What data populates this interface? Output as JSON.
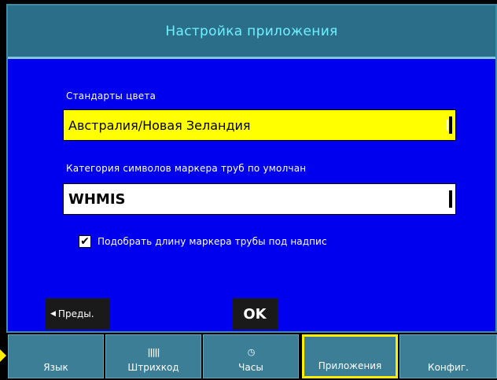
{
  "title": "Настройка приложения",
  "color_standards": {
    "label": "Стандарты цвета",
    "value": "Австралия/Новая Зеландия"
  },
  "pipe_marker_category": {
    "label": "Категория символов маркера труб по умолчан",
    "value": "WHMIS"
  },
  "fit_length": {
    "label": "Подобрать длину маркера трубы под надпис",
    "checked": true
  },
  "nav": {
    "prev_label": "Преды.",
    "ok_label": "OK"
  },
  "tabs": [
    {
      "label": "Язык",
      "icon": "",
      "icon_name": "",
      "active": false
    },
    {
      "label": "Штрихкод",
      "icon": "|||||",
      "icon_name": "barcode-icon",
      "active": false
    },
    {
      "label": "Часы",
      "icon": "◷",
      "icon_name": "clock-icon",
      "active": false
    },
    {
      "label": "Приложения",
      "icon": "",
      "icon_name": "",
      "active": true
    },
    {
      "label": "Конфиг.",
      "icon": "",
      "icon_name": "",
      "active": false
    }
  ],
  "colors": {
    "background": "#0000ee",
    "title_bg": "#2a6e8a",
    "title_text": "#6ff0ff",
    "highlight_field": "#ffff00",
    "tab_bg": "#3c7e96",
    "active_tab_border": "#ffee00"
  }
}
